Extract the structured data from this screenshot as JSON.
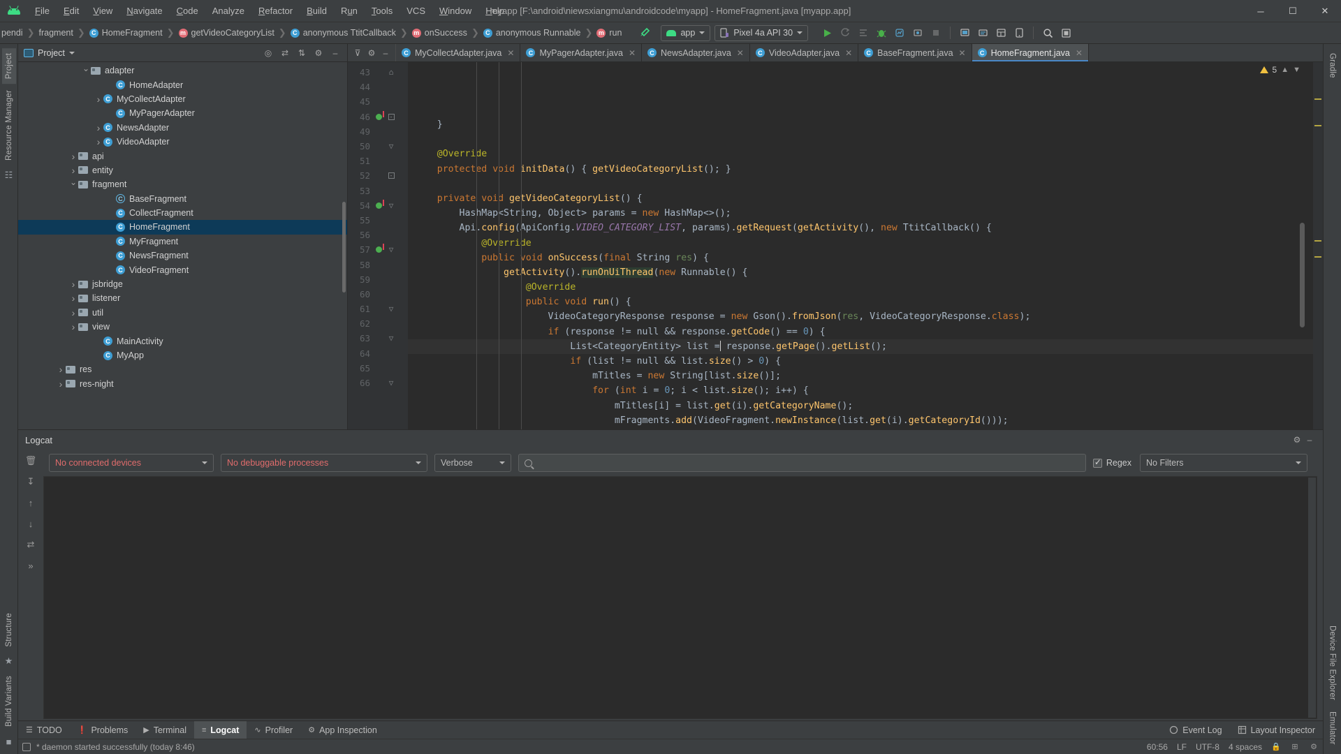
{
  "window": {
    "title": "myapp [F:\\android\\niewsxiangmu\\androidcode\\myapp] - HomeFragment.java [myapp.app]",
    "minimize": "─",
    "maximize": "☐",
    "close": "✕"
  },
  "menu": {
    "items": [
      "File",
      "Edit",
      "View",
      "Navigate",
      "Code",
      "Analyze",
      "Refactor",
      "Build",
      "Run",
      "Tools",
      "VCS",
      "Window",
      "Help"
    ]
  },
  "breadcrumbs": [
    {
      "label": "pendi",
      "icon": "none"
    },
    {
      "label": "fragment",
      "icon": "none"
    },
    {
      "label": "HomeFragment",
      "icon": "class-icon"
    },
    {
      "label": "getVideoCategoryList",
      "icon": "method-icon"
    },
    {
      "label": "anonymous TtitCallback",
      "icon": "anonymous-class-icon"
    },
    {
      "label": "onSuccess",
      "icon": "method-icon"
    },
    {
      "label": "anonymous Runnable",
      "icon": "anonymous-class-icon"
    },
    {
      "label": "run",
      "icon": "method-icon"
    }
  ],
  "toolbar": {
    "build_hammer": "hammer-icon",
    "module_selector": "app",
    "device_selector": "Pixel 4a API 30",
    "run_button": "run-icon",
    "rerun_button": "rerun-icon",
    "apply_changes": "apply-changes-icon",
    "debug_button": "debug-icon",
    "profile_button": "profile-icon",
    "attach_debugger": "attach-debugger-icon",
    "stop_button": "stop-icon",
    "avd_manager": "avd-manager-icon",
    "sdk_manager": "sdk-manager-icon",
    "sync_gradle": "sync-gradle-icon",
    "layout_inspector": "layout-inspector-icon",
    "search_everywhere": "search-icon",
    "settings": "gear-icon"
  },
  "project": {
    "tool_title": "Project",
    "tree": [
      {
        "label": "adapter",
        "indent": 5,
        "type": "folder",
        "arrow": "open"
      },
      {
        "label": "HomeAdapter",
        "indent": 7,
        "type": "class",
        "arrow": "none"
      },
      {
        "label": "MyCollectAdapter",
        "indent": 6,
        "type": "class",
        "arrow": "closed"
      },
      {
        "label": "MyPagerAdapter",
        "indent": 7,
        "type": "class",
        "arrow": "none"
      },
      {
        "label": "NewsAdapter",
        "indent": 6,
        "type": "class",
        "arrow": "closed"
      },
      {
        "label": "VideoAdapter",
        "indent": 6,
        "type": "class",
        "arrow": "closed"
      },
      {
        "label": "api",
        "indent": 4,
        "type": "folder",
        "arrow": "closed"
      },
      {
        "label": "entity",
        "indent": 4,
        "type": "folder",
        "arrow": "closed"
      },
      {
        "label": "fragment",
        "indent": 4,
        "type": "folder",
        "arrow": "open"
      },
      {
        "label": "BaseFragment",
        "indent": 7,
        "type": "abstract-class",
        "arrow": "none"
      },
      {
        "label": "CollectFragment",
        "indent": 7,
        "type": "class",
        "arrow": "none"
      },
      {
        "label": "HomeFragment",
        "indent": 7,
        "type": "class",
        "arrow": "none",
        "selected": true
      },
      {
        "label": "MyFragment",
        "indent": 7,
        "type": "class",
        "arrow": "none"
      },
      {
        "label": "NewsFragment",
        "indent": 7,
        "type": "class",
        "arrow": "none"
      },
      {
        "label": "VideoFragment",
        "indent": 7,
        "type": "class",
        "arrow": "none"
      },
      {
        "label": "jsbridge",
        "indent": 4,
        "type": "folder",
        "arrow": "closed"
      },
      {
        "label": "listener",
        "indent": 4,
        "type": "folder",
        "arrow": "closed"
      },
      {
        "label": "util",
        "indent": 4,
        "type": "folder",
        "arrow": "closed"
      },
      {
        "label": "view",
        "indent": 4,
        "type": "folder",
        "arrow": "closed"
      },
      {
        "label": "MainActivity",
        "indent": 6,
        "type": "class",
        "arrow": "none"
      },
      {
        "label": "MyApp",
        "indent": 6,
        "type": "class",
        "arrow": "none"
      },
      {
        "label": "res",
        "indent": 3,
        "type": "res-folder",
        "arrow": "closed"
      },
      {
        "label": "res-night",
        "indent": 3,
        "type": "res-folder",
        "arrow": "closed"
      }
    ]
  },
  "editor": {
    "tabs": [
      {
        "label": "MyCollectAdapter.java",
        "active": false
      },
      {
        "label": "MyPagerAdapter.java",
        "active": false
      },
      {
        "label": "NewsAdapter.java",
        "active": false
      },
      {
        "label": "VideoAdapter.java",
        "active": false
      },
      {
        "label": "BaseFragment.java",
        "active": false
      },
      {
        "label": "HomeFragment.java",
        "active": true
      }
    ],
    "warning_count": "5",
    "lines": [
      {
        "num": "43",
        "fold": "end"
      },
      {
        "num": "44"
      },
      {
        "num": "45"
      },
      {
        "num": "46",
        "fold": "box",
        "breakpoint": true
      },
      {
        "num": "49"
      },
      {
        "num": "50",
        "fold": "arrow"
      },
      {
        "num": "51"
      },
      {
        "num": "52",
        "fold": "box"
      },
      {
        "num": "53"
      },
      {
        "num": "54",
        "fold": "arrow",
        "breakpoint": true
      },
      {
        "num": "55"
      },
      {
        "num": "56"
      },
      {
        "num": "57",
        "fold": "arrow",
        "breakpoint": true
      },
      {
        "num": "58"
      },
      {
        "num": "59"
      },
      {
        "num": "60",
        "current": true
      },
      {
        "num": "61",
        "fold": "arrow"
      },
      {
        "num": "62"
      },
      {
        "num": "63",
        "fold": "arrow"
      },
      {
        "num": "64"
      },
      {
        "num": "65"
      },
      {
        "num": "66",
        "fold": "arrow"
      }
    ],
    "code_text": [
      "    }",
      "",
      "    @Override",
      "    protected void initData() { getVideoCategoryList(); }",
      "",
      "    private void getVideoCategoryList() {",
      "        HashMap<String, Object> params = new HashMap<>();",
      "        Api.config(ApiConfig.VIDEO_CATEGORY_LIST, params).getRequest(getActivity(), new TtitCallback() {",
      "            @Override",
      "            public void onSuccess(final String res) {",
      "                getActivity().runOnUiThread(new Runnable() {",
      "                    @Override",
      "                    public void run() {",
      "                        VideoCategoryResponse response = new Gson().fromJson(res, VideoCategoryResponse.class);",
      "                        if (response != null && response.getCode() == 0) {",
      "                            List<CategoryEntity> list = response.getPage().getList();",
      "                            if (list != null && list.size() > 0) {",
      "                                mTitles = new String[list.size()];",
      "                                for (int i = 0; i < list.size(); i++) {",
      "                                    mTitles[i] = list.get(i).getCategoryName();",
      "                                    mFragments.add(VideoFragment.newInstance(list.get(i).getCategoryId()));",
      "                                }"
    ]
  },
  "logcat": {
    "title": "Logcat",
    "device_selector": "No connected devices",
    "process_selector": "No debuggable processes",
    "level_selector": "Verbose",
    "search_placeholder": "",
    "regex_label": "Regex",
    "filter_selector": "No Filters",
    "settings_icon": "gear-icon",
    "minimize_icon": "minimize-icon"
  },
  "bottom_tabs": [
    {
      "label": "TODO",
      "icon": "todo-icon",
      "active": false
    },
    {
      "label": "Problems",
      "icon": "problems-icon",
      "active": false
    },
    {
      "label": "Terminal",
      "icon": "terminal-icon",
      "active": false
    },
    {
      "label": "Logcat",
      "icon": "logcat-icon",
      "active": true
    },
    {
      "label": "Profiler",
      "icon": "profiler-icon",
      "active": false
    },
    {
      "label": "App Inspection",
      "icon": "app-inspection-icon",
      "active": false
    }
  ],
  "bottom_right_tabs": [
    {
      "label": "Event Log",
      "icon": "event-log-icon"
    },
    {
      "label": "Layout Inspector",
      "icon": "layout-inspector-icon"
    }
  ],
  "statusbar": {
    "message": "* daemon started successfully (today 8:46)",
    "caret_position": "60:56",
    "line_separator": "LF",
    "encoding": "UTF-8",
    "indent": "4 spaces",
    "lock_icon": "lock-icon",
    "branch_icon": "branch-icon"
  },
  "left_rail": {
    "top_tabs": [
      "Project",
      "Resource Manager"
    ],
    "bottom_tabs": [
      "Structure",
      "Favorites",
      "Build Variants"
    ]
  },
  "right_rail": {
    "top_tabs": [
      "Gradle"
    ],
    "bottom_tabs": [
      "Device File Explorer",
      "Emulator"
    ]
  },
  "colors": {
    "accent": "#4a88c7",
    "selection": "#0d3a58",
    "keyword": "#cc7832",
    "method": "#ffc66d",
    "annotation": "#bbb529",
    "string": "#6a8759",
    "number": "#6897bb",
    "static_field": "#9876aa",
    "android_green": "#3ddc84",
    "error_red": "#e06c6c"
  }
}
